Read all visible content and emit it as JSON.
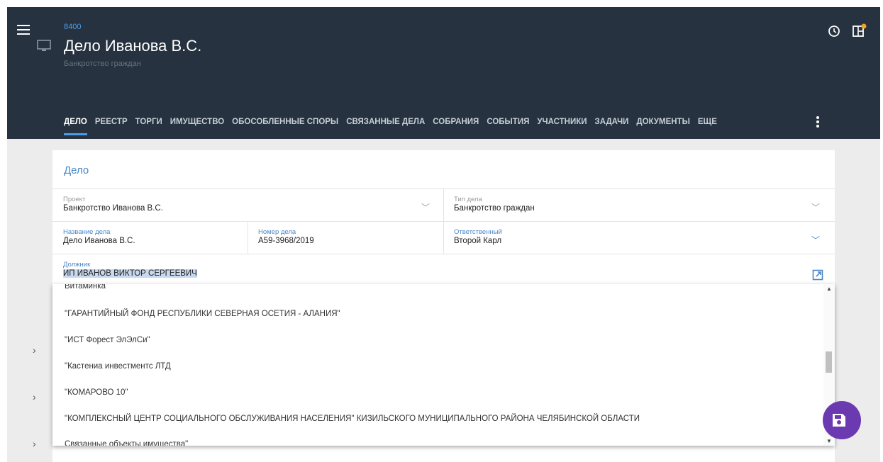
{
  "header": {
    "case_number": "8400",
    "case_title": "Дело Иванова В.С.",
    "case_subtitle": "Банкротство граждан"
  },
  "tabs": [
    {
      "label": "ДЕЛО"
    },
    {
      "label": "РЕЕСТР"
    },
    {
      "label": "ТОРГИ"
    },
    {
      "label": "ИМУЩЕСТВО"
    },
    {
      "label": "ОБОСОБЛЕННЫЕ СПОРЫ"
    },
    {
      "label": "СВЯЗАННЫЕ ДЕЛА"
    },
    {
      "label": "СОБРАНИЯ"
    },
    {
      "label": "СОБЫТИЯ"
    },
    {
      "label": "УЧАСТНИКИ"
    },
    {
      "label": "ЗАДАЧИ"
    },
    {
      "label": "ДОКУМЕНТЫ"
    },
    {
      "label": "ЕЩЕ"
    }
  ],
  "card": {
    "title": "Дело",
    "project": {
      "label": "Проект",
      "value": "Банкротство Иванова В.С."
    },
    "case_type": {
      "label": "Тип дела",
      "value": "Банкротство граждан"
    },
    "case_name": {
      "label": "Название дела",
      "value": "Дело Иванова В.С."
    },
    "case_no": {
      "label": "Номер дела",
      "value": "А59-3968/2019"
    },
    "responsible": {
      "label": "Ответственный",
      "value": "Второй Карл"
    },
    "debtor": {
      "label": "Должник",
      "value": "ИП ИВАНОВ ВИКТОР СЕРГЕЕВИЧ"
    }
  },
  "dropdown": {
    "items": [
      "Витаминка\"",
      "\"ГАРАНТИЙНЫЙ ФОНД РЕСПУБЛИКИ СЕВЕРНАЯ ОСЕТИЯ - АЛАНИЯ\"",
      "\"ИСТ Форест ЭлЭлСи\"",
      "\"Кастениа инвестментс ЛТД",
      "\"КОМАРОВО 10\"",
      "\"КОМПЛЕКСНЫЙ ЦЕНТР СОЦИАЛЬНОГО ОБСЛУЖИВАНИЯ НАСЕЛЕНИЯ\" КИЗИЛЬСКОГО МУНИЦИПАЛЬНОГО РАЙОНА ЧЕЛЯБИНСКОЙ ОБЛАСТИ",
      "Связанные объекты имущества\""
    ]
  },
  "colors": {
    "header_bg": "#26323f",
    "accent": "#4a87c8",
    "fab": "#6b3ab0",
    "notification_dot": "#f5a623"
  }
}
